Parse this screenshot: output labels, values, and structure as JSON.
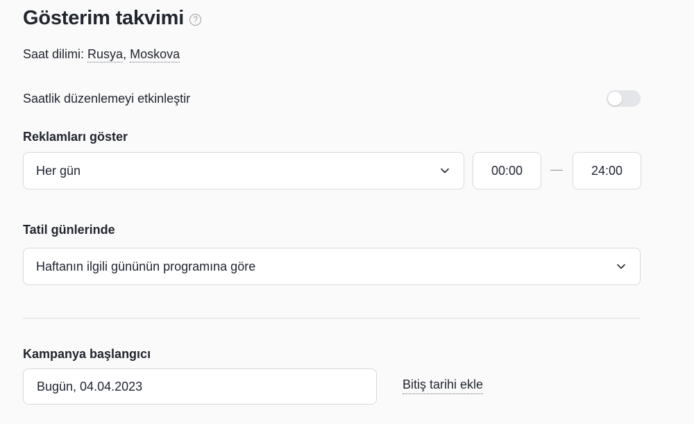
{
  "header": {
    "title": "Gösterim takvimi",
    "help_glyph": "?"
  },
  "timezone": {
    "label": "Saat dilimi:",
    "country": "Rusya",
    "separator": ",",
    "city": "Moskova"
  },
  "hourly_adjustment": {
    "label": "Saatlik düzenlemeyi etkinleştir",
    "enabled": false
  },
  "show_ads": {
    "label": "Reklamları göster",
    "days_value": "Her gün",
    "time_from": "00:00",
    "time_separator": "—",
    "time_to": "24:00"
  },
  "holidays": {
    "label": "Tatil günlerinde",
    "value": "Haftanın ilgili gününün programına göre"
  },
  "campaign_start": {
    "label": "Kampanya başlangıcı",
    "value": "Bugün, 04.04.2023",
    "add_end_date_label": "Bitiş tarihi ekle"
  },
  "icons": {
    "help": "help-circle-icon",
    "chevron": "chevron-down-icon"
  },
  "colors": {
    "text": "#21252e",
    "border": "#d6d8dd",
    "toggle_off": "#e4e5e8",
    "muted": "#9a9ca3"
  }
}
